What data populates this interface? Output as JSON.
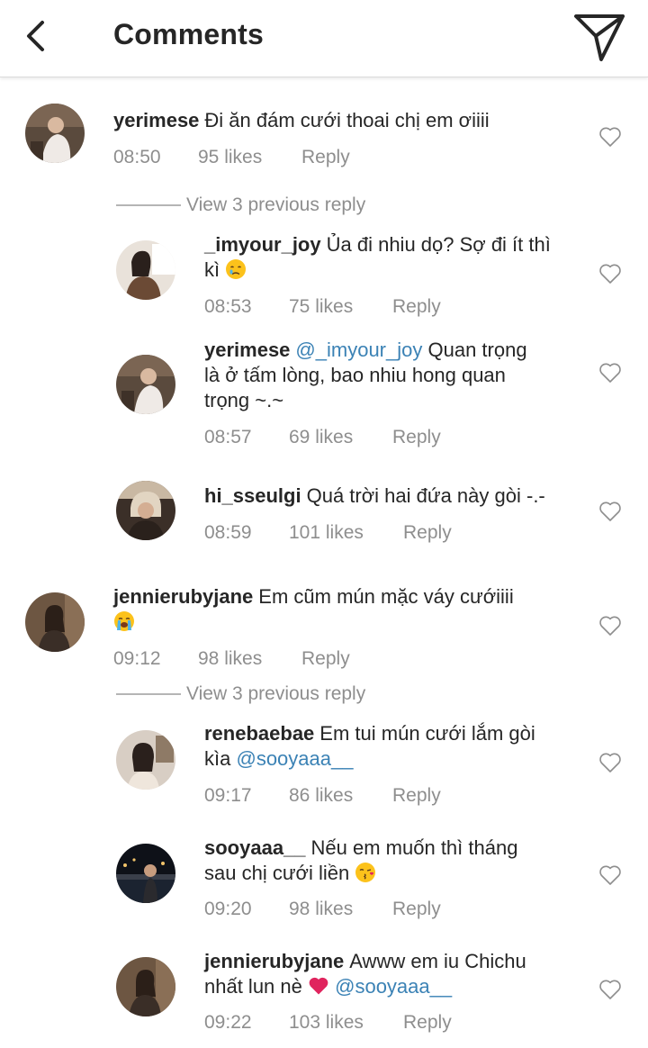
{
  "header": {
    "title": "Comments",
    "back_icon": "back-arrow-icon",
    "send_icon": "paper-plane-icon"
  },
  "colors": {
    "mention": "#3b82b5",
    "meta": "#8e8e8e",
    "text": "#262626",
    "heart": "#ed4956"
  },
  "comments": [
    {
      "username": "yerimese",
      "text": "Đi ăn đám cưới thoai chị em ơiiii",
      "time": "08:50",
      "likes": "95 likes",
      "reply": "Reply",
      "view_previous": "View 3 previous reply",
      "replies": [
        {
          "username": "_imyour_joy",
          "text_line1": "Ủa đi nhiu dọ? Sợ đi ít thì",
          "text_line2": "kì",
          "emoji": "crying-face-emoji",
          "time": "08:53",
          "likes": "75 likes",
          "reply": "Reply"
        },
        {
          "username": "yerimese",
          "mention": "@_imyour_joy",
          "text_after_mention": "Quan trọng",
          "text_line2": "là ở tấm lòng, bao nhiu hong quan",
          "text_line3": "trọng ~.~",
          "time": "08:57",
          "likes": "69 likes",
          "reply": "Reply"
        },
        {
          "username": "hi_sseulgi",
          "text": "Quá trời hai đứa này gòi -.-",
          "time": "08:59",
          "likes": "101 likes",
          "reply": "Reply"
        }
      ]
    },
    {
      "username": "jennierubyjane",
      "text": "Em cũm mún mặc váy cướiiii",
      "emoji": "loudly-crying-face-emoji",
      "time": "09:12",
      "likes": "98 likes",
      "reply": "Reply",
      "view_previous": "View 3 previous reply",
      "replies": [
        {
          "username": "renebaebae",
          "text": "Em tui mún cưới lắm gòi",
          "text_line2": "kìa",
          "mention": "@sooyaaa__",
          "time": "09:17",
          "likes": "86 likes",
          "reply": "Reply"
        },
        {
          "username": "sooyaaa__",
          "text": "Nếu em muốn thì tháng",
          "text_line2": "sau chị cưới liền",
          "emoji": "face-blowing-kiss-emoji",
          "time": "09:20",
          "likes": "98 likes",
          "reply": "Reply"
        },
        {
          "username": "jennierubyjane",
          "text": "Awww em iu Chichu",
          "text_line2": "nhất lun nè",
          "emoji": "red-heart-emoji",
          "mention": "@sooyaaa__",
          "time": "09:22",
          "likes": "103 likes",
          "reply": "Reply"
        }
      ]
    }
  ]
}
